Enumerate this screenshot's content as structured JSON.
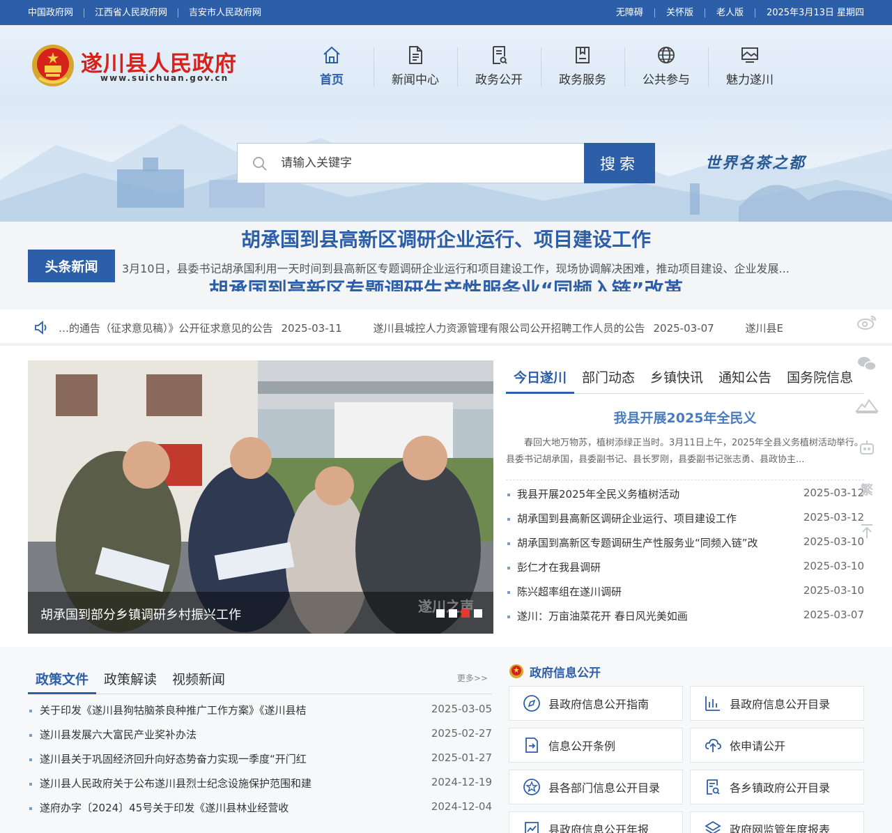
{
  "topbar": {
    "links": [
      "中国政府网",
      "江西省人民政府网",
      "吉安市人民政府网"
    ],
    "right": [
      "无障碍",
      "关怀版",
      "老人版"
    ],
    "date": "2025年3月13日 星期四"
  },
  "header": {
    "title": "遂川县人民政府",
    "url": "www.suichuan.gov.cn",
    "slogan": "世界名茶之都"
  },
  "nav": [
    {
      "label": "首页",
      "icon": "home-icon",
      "active": true
    },
    {
      "label": "新闻中心",
      "icon": "document-icon"
    },
    {
      "label": "政务公开",
      "icon": "file-search-icon"
    },
    {
      "label": "政务服务",
      "icon": "bookmark-icon"
    },
    {
      "label": "公共参与",
      "icon": "globe-icon"
    },
    {
      "label": "魅力遂川",
      "icon": "landscape-icon"
    }
  ],
  "search": {
    "placeholder": "请输入关键字",
    "button": "搜索"
  },
  "headline": {
    "tag": "头条新闻",
    "ghost_top": "胡承国到县高新区调研企业运行、项目建设工作",
    "summary": "3月10日，县委书记胡承国利用一天时间到县高新区专题调研企业运行和项目建设工作，现场协调解决困难，推动项目建设、企业发展...",
    "ghost_bottom": "胡承国到高新区专题调研生产性服务业“同频入链”改革"
  },
  "ticker": {
    "items": [
      {
        "title": "…的通告（征求意见稿）》公开征求意见的公告",
        "date": "2025-03-11"
      },
      {
        "title": "遂川县城控人力资源管理有限公司公开招聘工作人员的公告",
        "date": "2025-03-07"
      },
      {
        "title": "遂川县E",
        "date": ""
      }
    ]
  },
  "photo": {
    "caption": "胡承国到部分乡镇调研乡村振兴工作",
    "watermark": "遂川之声"
  },
  "news": {
    "tabs": [
      "今日遂川",
      "部门动态",
      "乡镇快讯",
      "通知公告",
      "国务院信息"
    ],
    "feature_title": "我县开展2025年全民义",
    "feature_summary": "春回大地万物苏，植树添绿正当时。3月11日上午，2025年全县义务植树活动举行。县委书记胡承国，县委副书记、县长罗刚，县委副书记张志勇、县政协主...",
    "items": [
      {
        "title": "我县开展2025年全民义务植树活动",
        "date": "2025-03-12"
      },
      {
        "title": "胡承国到县高新区调研企业运行、项目建设工作",
        "date": "2025-03-12"
      },
      {
        "title": "胡承国到高新区专题调研生产性服务业“同频入链”改",
        "date": "2025-03-10"
      },
      {
        "title": "彭仁才在我县调研",
        "date": "2025-03-10"
      },
      {
        "title": "陈兴超率组在遂川调研",
        "date": "2025-03-10"
      },
      {
        "title": "遂川：万亩油菜花开 春日风光美如画",
        "date": "2025-03-07"
      }
    ]
  },
  "policy": {
    "tabs": [
      "政策文件",
      "政策解读",
      "视频新闻"
    ],
    "more": "更多>>",
    "items": [
      {
        "title": "关于印发《遂川县狗牯脑茶良种推广工作方案》《遂川县桔",
        "date": "2025-03-05"
      },
      {
        "title": "遂川县发展六大富民产业奖补办法",
        "date": "2025-02-27"
      },
      {
        "title": "遂川县关于巩固经济回升向好态势奋力实现一季度“开门红",
        "date": "2025-01-27"
      },
      {
        "title": "遂川县人民政府关于公布遂川县烈士纪念设施保护范围和建",
        "date": "2024-12-19"
      },
      {
        "title": "遂府办字〔2024〕45号关于印发《遂川县林业经营收",
        "date": "2024-12-04"
      }
    ]
  },
  "gov": {
    "title": "政府信息公开",
    "cells": [
      {
        "label": "县政府信息公开指南",
        "icon": "compass-icon"
      },
      {
        "label": "县政府信息公开目录",
        "icon": "bar-chart-icon"
      },
      {
        "label": "信息公开条例",
        "icon": "doc-arrow-icon"
      },
      {
        "label": "依申请公开",
        "icon": "cloud-upload-icon"
      },
      {
        "label": "县各部门信息公开目录",
        "icon": "star-circle-icon"
      },
      {
        "label": "各乡镇政府公开目录",
        "icon": "doc-search-icon"
      },
      {
        "label": "县政府信息公开年报",
        "icon": "report-icon"
      },
      {
        "label": "政府网监管年度报表",
        "icon": "layers-icon"
      }
    ]
  },
  "side": {
    "traditional": "繁"
  },
  "colors": {
    "primary": "#2c5fa8",
    "title_red": "#d7221c"
  }
}
